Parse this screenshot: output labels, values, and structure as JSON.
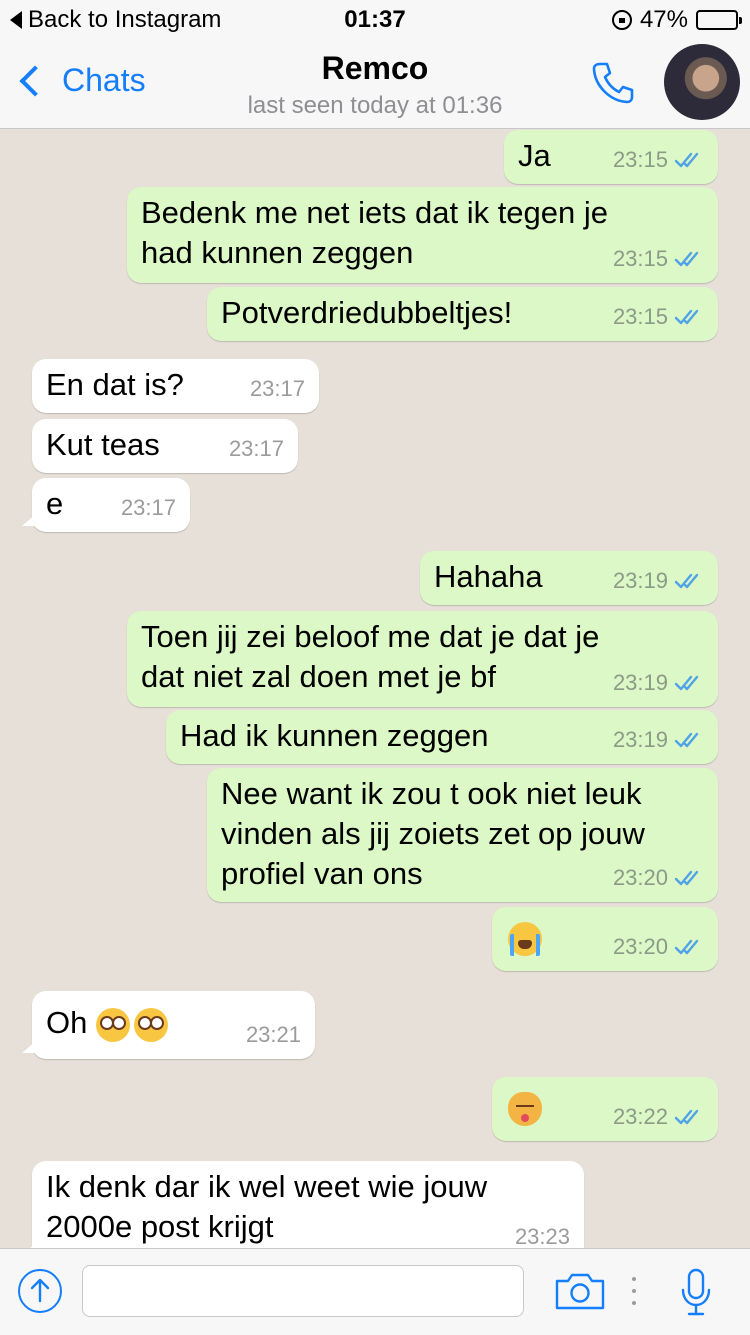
{
  "status_bar": {
    "back_label": "Back to Instagram",
    "time": "01:37",
    "battery": "47%",
    "battery_level": 0.47
  },
  "header": {
    "back_label": "Chats",
    "contact_name": "Remco",
    "last_seen": "last seen today at 01:36"
  },
  "messages": [
    {
      "dir": "out",
      "text": "Ja",
      "time": "23:15"
    },
    {
      "dir": "out",
      "text": "Bedenk me net iets dat ik tegen je\nhad kunnen zeggen",
      "time": "23:15"
    },
    {
      "dir": "out",
      "text": "Potverdriedubbeltjes!",
      "time": "23:15"
    },
    {
      "dir": "in",
      "text": "En dat is?",
      "time": "23:17"
    },
    {
      "dir": "in",
      "text": "Kut teas",
      "time": "23:17"
    },
    {
      "dir": "in",
      "text": "e",
      "time": "23:17"
    },
    {
      "dir": "out",
      "text": "Hahaha",
      "time": "23:19"
    },
    {
      "dir": "out",
      "text": "Toen jij zei beloof me dat je dat je\ndat niet zal doen met je bf",
      "time": "23:19"
    },
    {
      "dir": "out",
      "text": "Had ik kunnen zeggen",
      "time": "23:19"
    },
    {
      "dir": "out",
      "text": "Nee want ik zou t ook niet leuk\nvinden als jij zoiets zet op jouw\nprofiel van ons",
      "time": "23:20"
    },
    {
      "dir": "out",
      "text": "",
      "emoji": "loudly-crying-face",
      "time": "23:20"
    },
    {
      "dir": "in",
      "text": "Oh",
      "emoji": "flushed-face x2",
      "time": "23:21"
    },
    {
      "dir": "out",
      "text": "",
      "emoji": "kissing-cat-face",
      "time": "23:22"
    },
    {
      "dir": "in",
      "text": "Ik denk dar ik wel weet wie jouw\n2000e post krijgt",
      "time": "23:23"
    }
  ],
  "input": {
    "placeholder": ""
  },
  "colors": {
    "accent": "#147efb",
    "outgoing_bubble": "#dcf8c6",
    "incoming_bubble": "#ffffff",
    "read_ticks": "#4fa3e6",
    "chat_background": "#e6e0d8"
  },
  "icons": [
    "phone-icon",
    "camera-icon",
    "microphone-icon",
    "share-up-arrow-icon",
    "double-check-icon"
  ]
}
